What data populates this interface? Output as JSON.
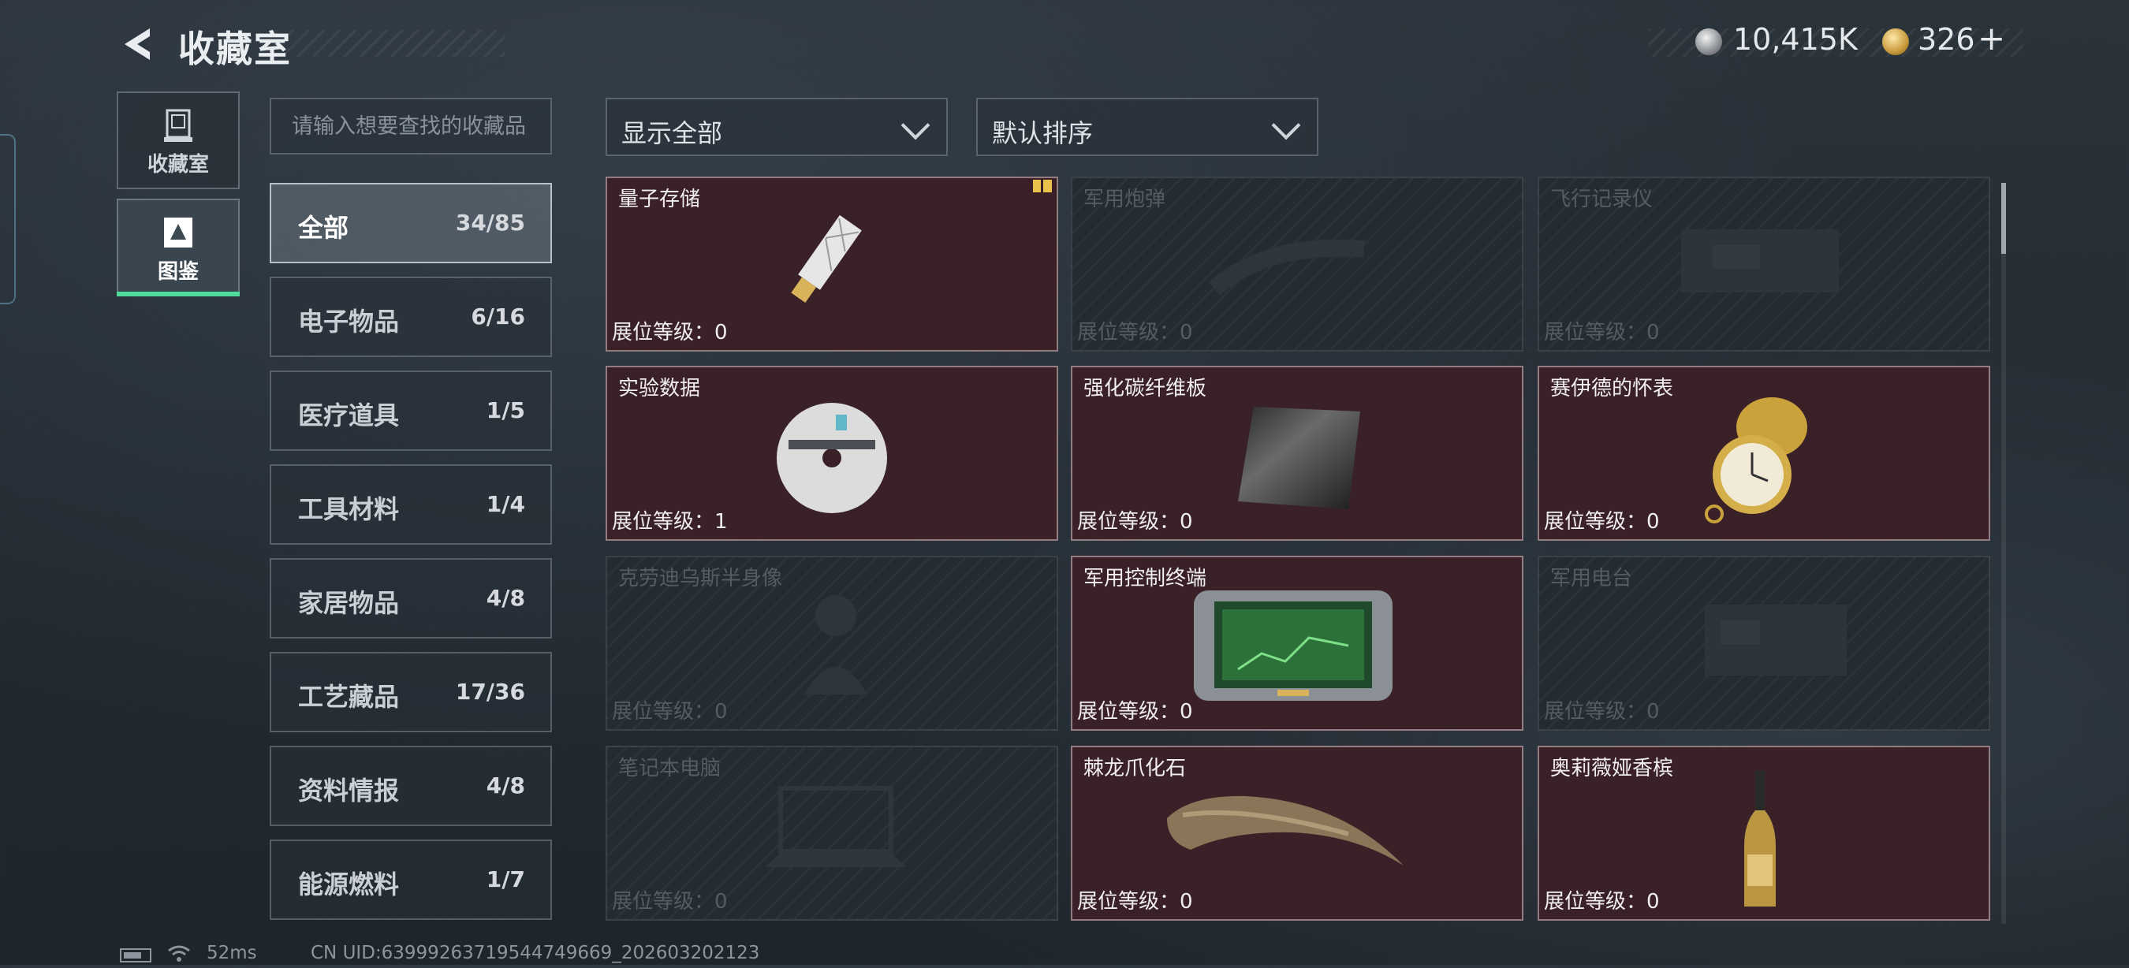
{
  "header": {
    "title": "收藏室"
  },
  "currency": {
    "silver": "10,415K",
    "gold": "326",
    "add": "+"
  },
  "side_tabs": [
    {
      "label": "收藏室",
      "icon": "collection-box-icon"
    },
    {
      "label": "图鉴",
      "icon": "catalog-icon"
    }
  ],
  "search": {
    "placeholder": "请输入想要查找的收藏品"
  },
  "categories": [
    {
      "name": "全部",
      "count": "34/85"
    },
    {
      "name": "电子物品",
      "count": "6/16"
    },
    {
      "name": "医疗道具",
      "count": "1/5"
    },
    {
      "name": "工具材料",
      "count": "1/4"
    },
    {
      "name": "家居物品",
      "count": "4/8"
    },
    {
      "name": "工艺藏品",
      "count": "17/36"
    },
    {
      "name": "资料情报",
      "count": "4/8"
    },
    {
      "name": "能源燃料",
      "count": "1/7"
    }
  ],
  "filters": {
    "filter_label": "显示全部",
    "sort_label": "默认排序"
  },
  "items": [
    {
      "name": "量子存储",
      "level": "展位等级：0",
      "owned": true,
      "icon": "usb-drive-icon"
    },
    {
      "name": "军用炮弹",
      "level": "展位等级：0",
      "owned": false,
      "icon": "artillery-shell-icon"
    },
    {
      "name": "飞行记录仪",
      "level": "展位等级：0",
      "owned": false,
      "icon": "flight-recorder-icon"
    },
    {
      "name": "实验数据",
      "level": "展位等级：1",
      "owned": true,
      "icon": "data-disc-icon"
    },
    {
      "name": "强化碳纤维板",
      "level": "展位等级：0",
      "owned": true,
      "icon": "carbon-plate-icon"
    },
    {
      "name": "赛伊德的怀表",
      "level": "展位等级：0",
      "owned": true,
      "icon": "pocket-watch-icon"
    },
    {
      "name": "克劳迪乌斯半身像",
      "level": "展位等级：0",
      "owned": false,
      "icon": "bust-statue-icon"
    },
    {
      "name": "军用控制终端",
      "level": "展位等级：0",
      "owned": true,
      "icon": "control-terminal-icon"
    },
    {
      "name": "军用电台",
      "level": "展位等级：0",
      "owned": false,
      "icon": "military-radio-icon"
    },
    {
      "name": "笔记本电脑",
      "level": "展位等级：0",
      "owned": false,
      "icon": "laptop-icon"
    },
    {
      "name": "棘龙爪化石",
      "level": "展位等级：0",
      "owned": true,
      "icon": "claw-fossil-icon"
    },
    {
      "name": "奥莉薇娅香槟",
      "level": "展位等级：0",
      "owned": true,
      "icon": "champagne-bottle-icon"
    }
  ],
  "status_bar": {
    "ping": "52ms",
    "uid": "CN UID:6399926371954474966​9_202603202123"
  }
}
